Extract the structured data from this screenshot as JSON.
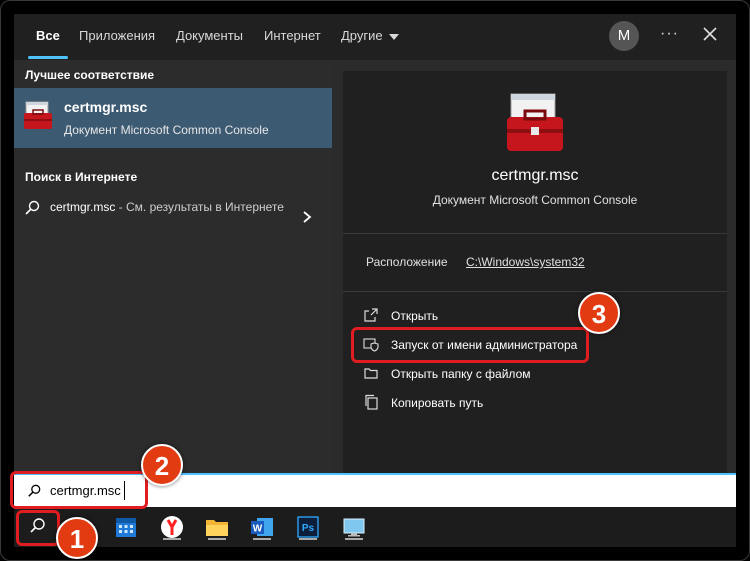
{
  "tabs": [
    "Все",
    "Приложения",
    "Документы",
    "Интернет",
    "Другие"
  ],
  "avatar_initial": "M",
  "left": {
    "best_match_header": "Лучшее соответствие",
    "best_match": {
      "title": "certmgr.msc",
      "subtitle": "Документ Microsoft Common Console"
    },
    "web_header": "Поиск в Интернете",
    "web_item": {
      "query": "certmgr.msc",
      "suffix": " - См. результаты в Интернете"
    }
  },
  "detail": {
    "app_name": "certmgr.msc",
    "app_type": "Документ Microsoft Common Console",
    "location_label": "Расположение",
    "location_value": "C:\\Windows\\system32",
    "actions": [
      "Открыть",
      "Запуск от имени администратора",
      "Открыть папку с файлом",
      "Копировать путь"
    ]
  },
  "search": {
    "value": "certmgr.msc"
  },
  "badges": [
    "1",
    "2",
    "3"
  ],
  "colors": {
    "accent": "#4cc2ff",
    "selection": "#3d5a73",
    "annotation": "#e01d20",
    "badge": "#e23b12"
  }
}
